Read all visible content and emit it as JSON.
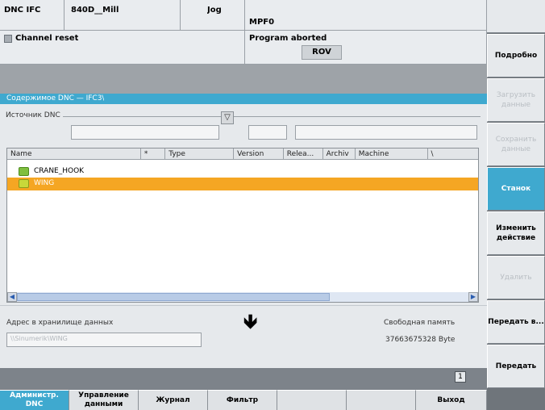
{
  "header": {
    "channel": "DNC IFC",
    "machine": "840D__Mill",
    "mode": "Jog",
    "program": "MPF0",
    "channel_status": "Channel reset",
    "program_status": "Program aborted",
    "rov": "ROV"
  },
  "panel": {
    "title": "Содержимое DNC — IFC3\\",
    "source_label": "Источник DNC",
    "columns": [
      "Name",
      "*",
      "Type",
      "Version",
      "Relea...",
      "Archiv",
      "Machine",
      "\\"
    ],
    "rows": [
      {
        "name": "CRANE_HOOK",
        "selected": false
      },
      {
        "name": "WING",
        "selected": true
      }
    ],
    "address_label": "Адрес в хранилище данных",
    "address_value": "\\\\Sinumerik\\WING",
    "free_memory_label": "Свободная память",
    "free_memory_value": "37663675328 Byte",
    "page_indicator": "1"
  },
  "softkeys": [
    {
      "label": "Подробно",
      "state": "normal"
    },
    {
      "label": "Загрузить данные",
      "state": "disabled"
    },
    {
      "label": "Сохранить данные",
      "state": "disabled"
    },
    {
      "label": "Станок",
      "state": "active"
    },
    {
      "label": "Изменить действие",
      "state": "normal"
    },
    {
      "label": "Удалить",
      "state": "disabled"
    },
    {
      "label": "Передать в...",
      "state": "normal"
    },
    {
      "label": "Передать",
      "state": "normal"
    }
  ],
  "hsoftkeys": [
    {
      "label": "Администр. DNC",
      "state": "active"
    },
    {
      "label": "Управление данными",
      "state": "normal"
    },
    {
      "label": "Журнал",
      "state": "normal"
    },
    {
      "label": "Фильтр",
      "state": "normal"
    },
    {
      "label": "",
      "state": "normal"
    },
    {
      "label": "",
      "state": "normal"
    },
    {
      "label": "Выход",
      "state": "normal"
    }
  ],
  "colors": {
    "selection": "#f5a623",
    "title_bar": "#3fa9cf",
    "dark_band": "#9ea3a8"
  }
}
